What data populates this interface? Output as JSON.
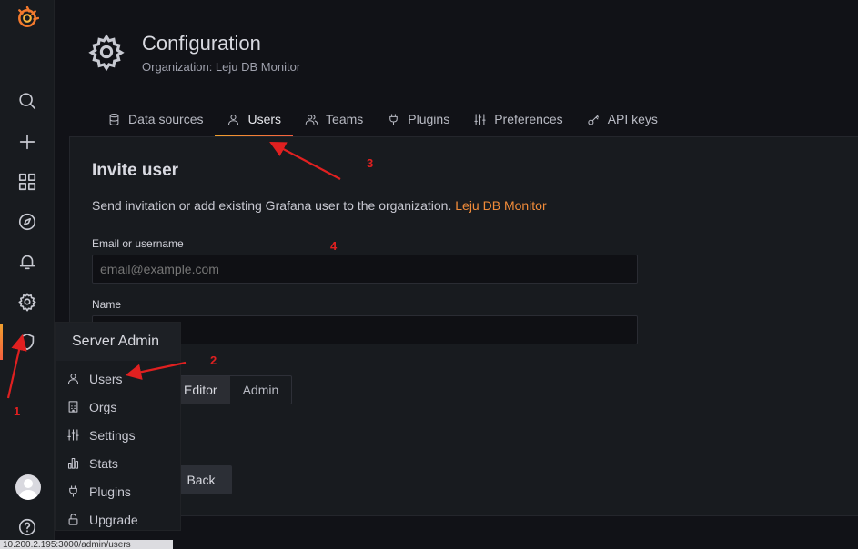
{
  "sidebar": {
    "logo_icon": "grafana-logo-icon",
    "items": [
      {
        "icon": "search-icon"
      },
      {
        "icon": "plus-icon"
      },
      {
        "icon": "dashboards-grid-icon"
      },
      {
        "icon": "explore-compass-icon"
      },
      {
        "icon": "alerting-bell-icon"
      },
      {
        "icon": "configuration-gear-icon"
      },
      {
        "icon": "server-admin-shield-icon"
      }
    ],
    "bottom": [
      {
        "icon": "avatar"
      },
      {
        "icon": "help-icon"
      }
    ]
  },
  "header": {
    "title": "Configuration",
    "subtitle": "Organization: Leju DB Monitor"
  },
  "tabs": [
    {
      "label": "Data sources",
      "icon": "database-icon"
    },
    {
      "label": "Users",
      "icon": "user-icon",
      "active": true
    },
    {
      "label": "Teams",
      "icon": "users-icon"
    },
    {
      "label": "Plugins",
      "icon": "plug-icon"
    },
    {
      "label": "Preferences",
      "icon": "sliders-icon"
    },
    {
      "label": "API keys",
      "icon": "key-icon"
    }
  ],
  "invite": {
    "title": "Invite user",
    "description": "Send invitation or add existing Grafana user to the organization.",
    "org_link": "Leju DB Monitor",
    "email_label": "Email or username",
    "email_placeholder": "email@example.com",
    "name_label": "Name",
    "name_value": "",
    "roles": [
      "Editor",
      "Admin"
    ],
    "selected_role": "Editor",
    "back_label": "Back"
  },
  "flyout": {
    "title": "Server Admin",
    "items": [
      {
        "label": "Users",
        "icon": "user-icon"
      },
      {
        "label": "Orgs",
        "icon": "building-icon"
      },
      {
        "label": "Settings",
        "icon": "sliders-icon"
      },
      {
        "label": "Stats",
        "icon": "bar-chart-icon"
      },
      {
        "label": "Plugins",
        "icon": "plug-icon"
      },
      {
        "label": "Upgrade",
        "icon": "unlock-icon"
      }
    ]
  },
  "status_tip": "10.200.2.195:3000/admin/users",
  "annotations": [
    "1",
    "2",
    "3",
    "4"
  ],
  "colors": {
    "accent": "#f28c3a",
    "annotation": "#e02020",
    "background": "#111217",
    "panel": "#181b1f"
  }
}
